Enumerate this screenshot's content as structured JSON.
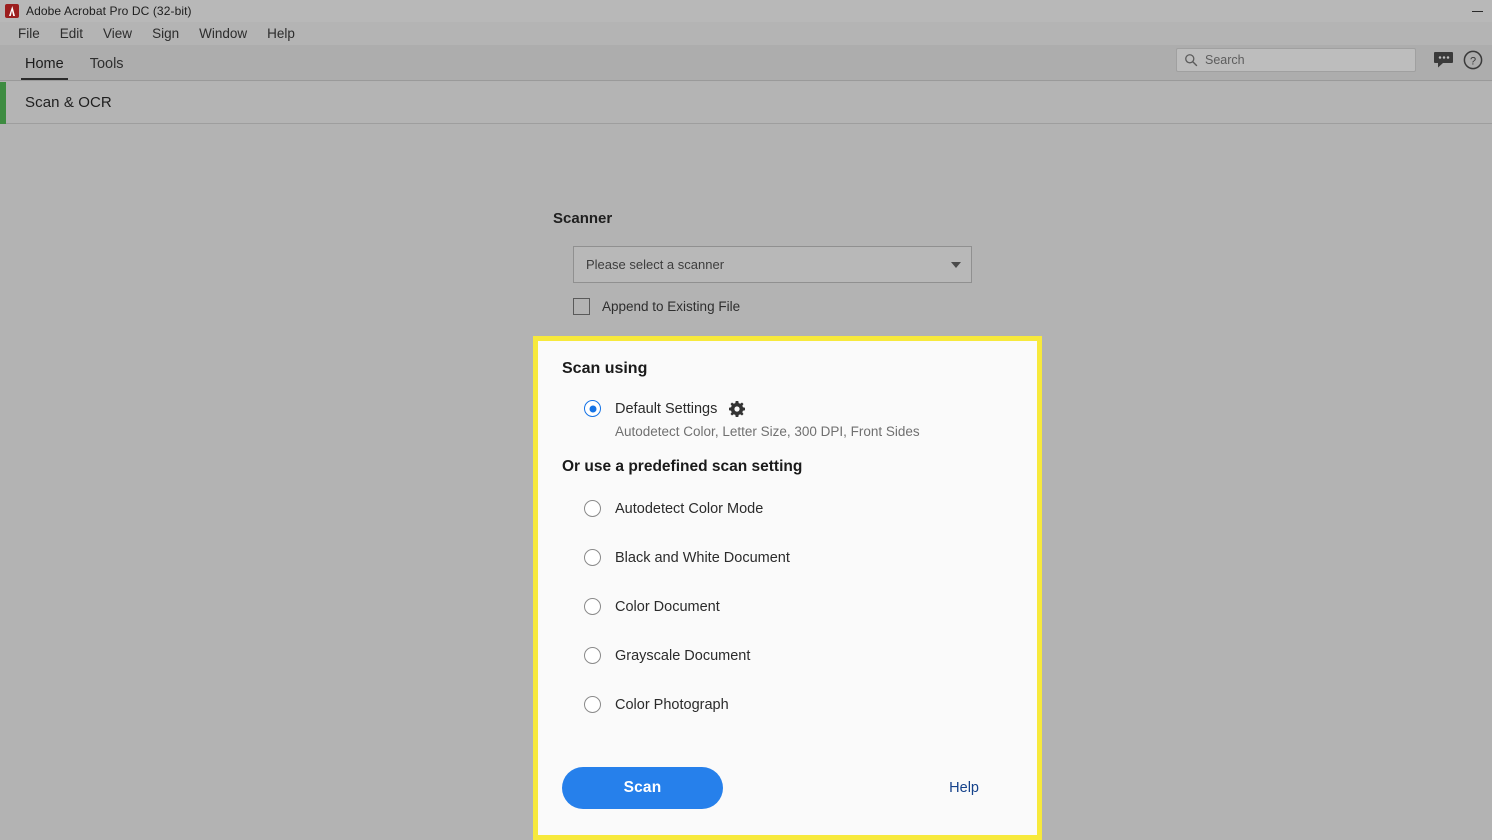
{
  "window": {
    "title": "Adobe Acrobat Pro DC (32-bit)",
    "app_icon": "adobe-acrobat-icon",
    "minimize_label": "Minimize"
  },
  "menubar": {
    "items": [
      {
        "label": "File"
      },
      {
        "label": "Edit"
      },
      {
        "label": "View"
      },
      {
        "label": "Sign"
      },
      {
        "label": "Window"
      },
      {
        "label": "Help"
      }
    ]
  },
  "toolbar": {
    "tabs": [
      {
        "label": "Home",
        "active": true
      },
      {
        "label": "Tools",
        "active": false
      }
    ],
    "search": {
      "placeholder": "Search",
      "value": "",
      "icon": "search-icon"
    },
    "icons": [
      {
        "name": "comment-icon"
      },
      {
        "name": "help-circle-icon"
      }
    ]
  },
  "subheader": {
    "title": "Scan & OCR",
    "accent_color": "#3e8c41"
  },
  "scanner": {
    "section_label": "Scanner",
    "select_value": "Please select a scanner",
    "append_label": "Append to Existing File",
    "append_checked": false
  },
  "scan_panel": {
    "highlight_color": "#f7e93c",
    "heading": "Scan using",
    "default_option": {
      "label": "Default Settings",
      "selected": true,
      "gear_icon": "gear-icon",
      "description": "Autodetect Color, Letter Size, 300 DPI, Front Sides"
    },
    "predefined_heading": "Or use a predefined scan setting",
    "options": [
      {
        "label": "Autodetect Color Mode",
        "selected": false
      },
      {
        "label": "Black and White Document",
        "selected": false
      },
      {
        "label": "Color Document",
        "selected": false
      },
      {
        "label": "Grayscale Document",
        "selected": false
      },
      {
        "label": "Color Photograph",
        "selected": false
      }
    ],
    "scan_button": "Scan",
    "scan_button_color": "#2680eb",
    "help_link": "Help",
    "help_link_color": "#15428b"
  }
}
